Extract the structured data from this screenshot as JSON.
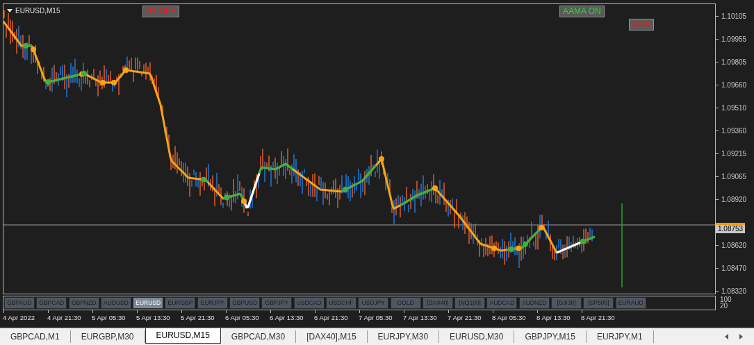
{
  "chart": {
    "symbol": "EURUSD,M15",
    "buttons": [
      {
        "label": "H1 OFF",
        "on": false
      },
      {
        "label": "AAMA ON",
        "on": true
      },
      {
        "label": "AMA",
        "on": false
      }
    ],
    "price_labels": [
      "1.10105",
      "1.09955",
      "1.09805",
      "1.09660",
      "1.09510",
      "1.09360",
      "1.09215",
      "1.09065",
      "1.08920",
      "1.08620",
      "1.08470",
      "1.08320"
    ],
    "current_price": "1.08753"
  },
  "indicator": {
    "levels": [
      "100",
      "20"
    ]
  },
  "symbol_buttons": [
    {
      "label": "GBPAUD",
      "selected": false
    },
    {
      "label": "GBPCAD",
      "selected": false
    },
    {
      "label": "GBPNZD",
      "selected": false
    },
    {
      "label": "AUDUSD",
      "selected": false
    },
    {
      "label": "EURUSD",
      "selected": true
    },
    {
      "label": "EURGBP",
      "selected": false
    },
    {
      "label": "EURJPY",
      "selected": false
    },
    {
      "label": "GBPUSD",
      "selected": false
    },
    {
      "label": "GBPJPY",
      "selected": false
    },
    {
      "label": "USDCAD",
      "selected": false
    },
    {
      "label": "USDCHF",
      "selected": false
    },
    {
      "label": "USDJPY",
      "selected": false
    },
    {
      "label": "GOLD",
      "selected": false
    },
    {
      "label": "[DAX40]",
      "selected": false
    },
    {
      "label": "[NQ100]",
      "selected": false
    },
    {
      "label": "AUDCAD",
      "selected": false
    },
    {
      "label": "AUDNZD",
      "selected": false
    },
    {
      "label": "[DJI30]",
      "selected": false
    },
    {
      "label": "[SP500]",
      "selected": false
    },
    {
      "label": "EURAUD",
      "selected": false
    }
  ],
  "time_labels": [
    "4 Apr 2022",
    "4 Apr 21:30",
    "5 Apr 05:30",
    "5 Apr 13:30",
    "5 Apr 21:30",
    "6 Apr 05:30",
    "6 Apr 13:30",
    "6 Apr 21:30",
    "7 Apr 05:30",
    "7 Apr 13:30",
    "7 Apr 21:30",
    "8 Apr 05:30",
    "8 Apr 13:30",
    "8 Apr 21:30"
  ],
  "tabs": [
    {
      "label": "GBPCAD,M1",
      "selected": false
    },
    {
      "label": "EURGBP,M30",
      "selected": false
    },
    {
      "label": "EURUSD,M15",
      "selected": true
    },
    {
      "label": "GBPCAD,M30",
      "selected": false
    },
    {
      "label": "[DAX40],M15",
      "selected": false
    },
    {
      "label": "EURJPY,M30",
      "selected": false
    },
    {
      "label": "EURUSD,M30",
      "selected": false
    },
    {
      "label": "GBPJPY,M15",
      "selected": false
    },
    {
      "label": "EURJPY,M1",
      "selected": false
    }
  ]
}
